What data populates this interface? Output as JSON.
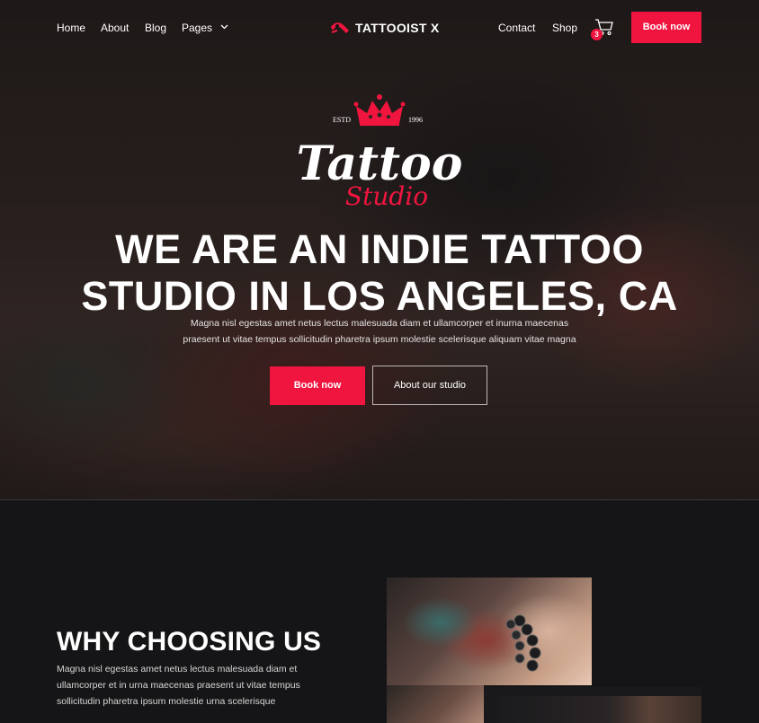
{
  "nav": {
    "home": "Home",
    "about": "About",
    "blog": "Blog",
    "pages": "Pages",
    "brand": "TATTOOIST X",
    "contact": "Contact",
    "shop": "Shop",
    "cart_count": "3",
    "book": "Book now"
  },
  "logo": {
    "estd": "ESTD",
    "year": "1996",
    "word1": "Tattoo",
    "word2": "Studio"
  },
  "hero": {
    "title_line1": "WE ARE AN INDIE TATTOO",
    "title_line2": "STUDIO IN LOS ANGELES, CA",
    "subtitle_line1": "Magna nisl egestas amet netus lectus malesuada diam et ullamcorper et inurna maecenas",
    "subtitle_line2": "praesent ut vitae tempus sollicitudin pharetra ipsum molestie scelerisque aliquam vitae magna",
    "primary_button": "Book now",
    "secondary_button": "About our studio"
  },
  "why": {
    "title": "WHY CHOOSING US",
    "text_line1": "Magna nisl egestas amet netus lectus malesuada diam et",
    "text_line2": "ullamcorper et in urna maecenas praesent ut vitae tempus",
    "text_line3": "sollicitudin pharetra ipsum molestie urna scelerisque"
  },
  "colors": {
    "accent": "#f0153f",
    "background": "#151517"
  },
  "icons": {
    "cart": "cart-icon",
    "chevron": "chevron-down-icon",
    "brand_logo": "tattoo-machine-logo-icon",
    "crown": "crown-icon"
  }
}
